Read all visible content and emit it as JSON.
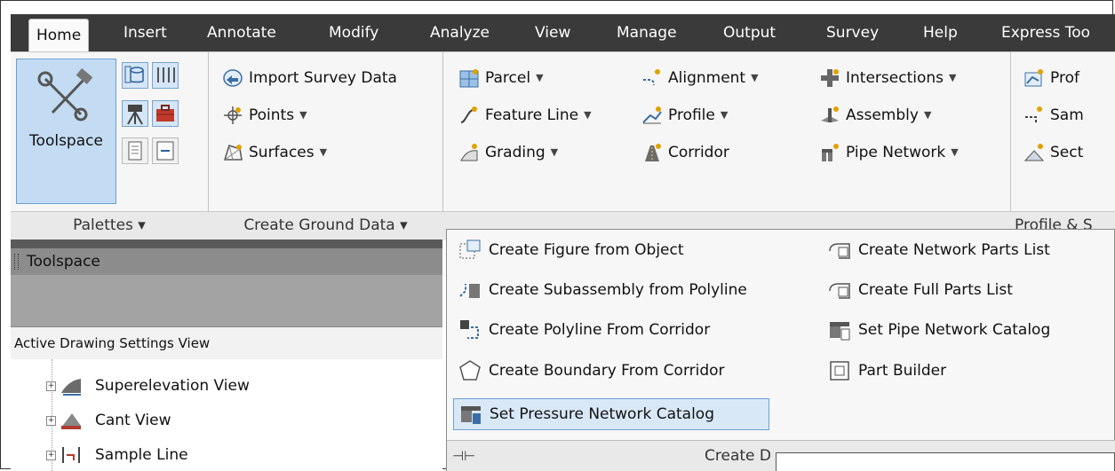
{
  "tabs": [
    "Home",
    "Insert",
    "Annotate",
    "Modify",
    "Analyze",
    "View",
    "Manage",
    "Output",
    "Survey",
    "Help",
    "Express Too"
  ],
  "palettes_panel": {
    "big_button_label": "Toolspace",
    "panel_label": "Palettes ▾"
  },
  "create_ground_panel": {
    "items": [
      "Import Survey Data",
      "Points",
      "Surfaces"
    ],
    "panel_label": "Create Ground Data ▾"
  },
  "create_design_panel": {
    "col1": [
      "Parcel",
      "Feature Line",
      "Grading"
    ],
    "col2": [
      "Alignment",
      "Profile",
      "Corridor"
    ],
    "col3": [
      "Intersections",
      "Assembly",
      "Pipe Network"
    ]
  },
  "profile_panel": {
    "items": [
      "Prof",
      "Sam",
      "Sect"
    ],
    "panel_label": "Profile & S"
  },
  "toolspace": {
    "title": "Toolspace",
    "view_label": "Active Drawing Settings View",
    "tree": [
      "Superelevation View",
      "Cant View",
      "Sample Line"
    ]
  },
  "dropdown": {
    "col1": [
      "Create Figure from Object",
      "Create Subassembly from Polyline",
      "Create Polyline From Corridor",
      "Create Boundary From Corridor",
      "Set Pressure Network Catalog"
    ],
    "col2": [
      "Create Network Parts List",
      "Create Full Parts List",
      "Set Pipe Network Catalog",
      "Part Builder"
    ],
    "footer_label": "Create D"
  },
  "colors": {
    "tabbar": "#3a3a3a",
    "accent": "#6a9fd0",
    "selected": "#d9e8f7"
  }
}
